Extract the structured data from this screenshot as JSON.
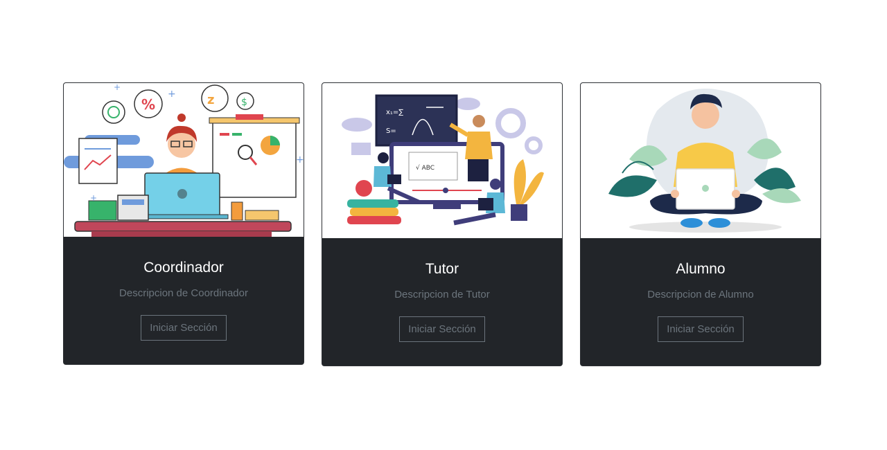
{
  "cards": [
    {
      "title": "Coordinador",
      "description": "Descripcion de Coordinador",
      "button_label": "Iniciar Sección",
      "image": "coordinator-illustration"
    },
    {
      "title": "Tutor",
      "description": "Descripcion de Tutor",
      "button_label": "Iniciar Sección",
      "image": "tutor-illustration"
    },
    {
      "title": "Alumno",
      "description": "Descripcion de Alumno",
      "button_label": "Iniciar Sección",
      "image": "student-illustration"
    }
  ],
  "colors": {
    "card_body_bg": "#222529",
    "title_text": "#ffffff",
    "muted_text": "#6c757d"
  }
}
